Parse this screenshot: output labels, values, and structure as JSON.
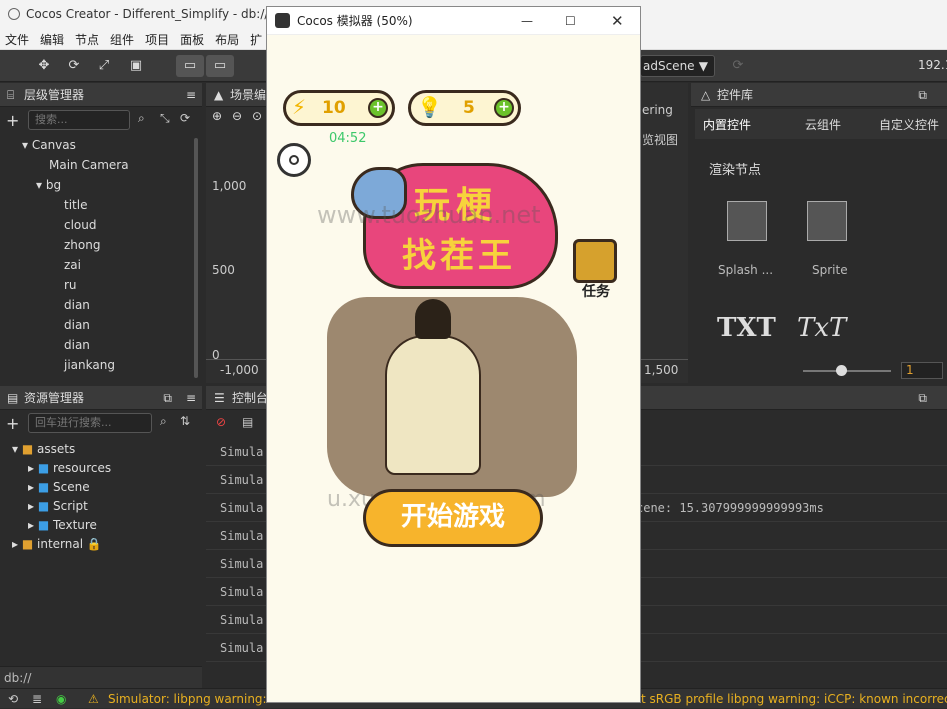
{
  "window": {
    "title": "Cocos Creator - Different_Simplify - db://asse"
  },
  "menu": [
    "文件",
    "编辑",
    "节点",
    "组件",
    "项目",
    "面板",
    "布局",
    "扩"
  ],
  "toolbar": {
    "scene_select": "adScene",
    "ip_fragment": "192.1"
  },
  "hierarchy": {
    "title": "层级管理器",
    "search_placeholder": "搜索...",
    "items": [
      "Canvas",
      "Main Camera",
      "bg",
      "title",
      "cloud",
      "zhong",
      "zai",
      "ru",
      "dian",
      "dian",
      "dian",
      "jiankang"
    ]
  },
  "scene": {
    "title": "场景编",
    "ticks_y": [
      "1,000",
      "500",
      "0"
    ],
    "ticks_x": [
      "-1,000"
    ]
  },
  "assets": {
    "title": "资源管理器",
    "search_placeholder": "回车进行搜索...",
    "items": [
      "assets",
      "resources",
      "Scene",
      "Script",
      "Texture",
      "internal"
    ],
    "footer": "db://"
  },
  "console": {
    "title": "控制台",
    "lines": [
      "Simula",
      "Simula",
      "Simula",
      "Simula",
      "Simula",
      "Simula",
      "Simula",
      "Simula"
    ],
    "right_text": "cene: 15.307999999999993ms"
  },
  "preview_labels": {
    "a": "ering",
    "b": "览视图",
    "tick": "1,500"
  },
  "widgets": {
    "title": "控件库",
    "tabs": [
      "内置控件",
      "云组件",
      "自定义控件"
    ],
    "section": "渲染节点",
    "items": [
      "Splash ...",
      "Sprite"
    ],
    "txt1": "TXT",
    "txt2": "TxT",
    "slider_value": "1"
  },
  "simulator": {
    "title": "Cocos 模拟器 (50%)",
    "energy": "10",
    "hints": "5",
    "timer": "04:52",
    "logo_line1": "玩梗",
    "logo_line2": "找茬王",
    "task": "任务",
    "start": "开始游戏",
    "watermark1": "www.tuozhuan.net",
    "watermark2": "u.xuanyuanma.com"
  },
  "status": {
    "warning": "Simulator: libpng warning: iCC",
    "warning_right": "t sRGB profile libpng warning: iCCP: known incorrect sRC"
  }
}
